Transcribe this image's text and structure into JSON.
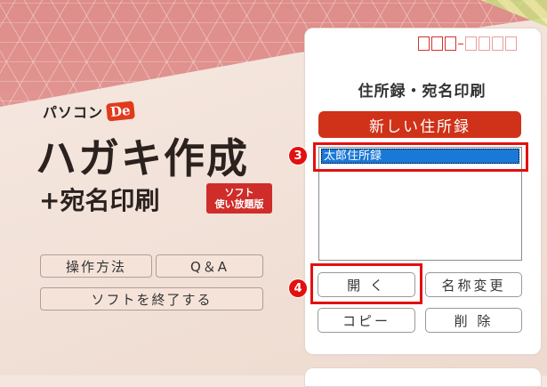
{
  "brand": {
    "prefix": "パソコン",
    "logo": "De"
  },
  "title": {
    "main": "ハガキ作成",
    "sub": "+宛名印刷"
  },
  "badge": {
    "line1": "ソフト",
    "line2": "使い放題版"
  },
  "left_buttons": {
    "howto": "操作方法",
    "qa": "Q＆A",
    "quit": "ソフトを終了する"
  },
  "panel": {
    "title": "住所録・宛名印刷",
    "new_button": "新しい住所録",
    "list_items": [
      "太郎住所録"
    ],
    "open_button": "開 く",
    "rename_button": "名称変更",
    "copy_button": "コピー",
    "delete_button": "削 除"
  },
  "markers": {
    "step3": "3",
    "step4": "4"
  },
  "colors": {
    "accent_red": "#cf3218",
    "highlight_red": "#e2100f",
    "selection_blue": "#1a78d7"
  }
}
